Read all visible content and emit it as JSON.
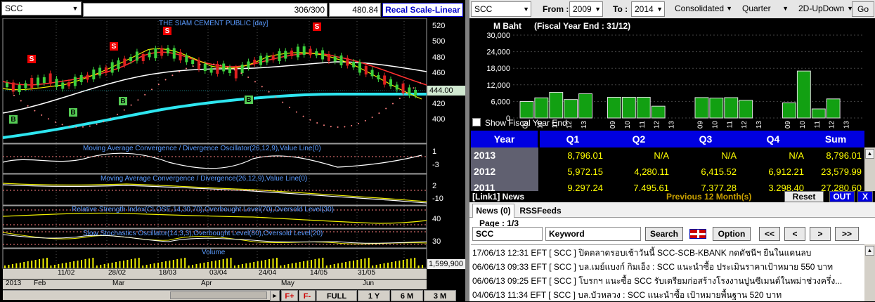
{
  "left": {
    "symbol": "SCC",
    "counter": "306/300",
    "price_readout": "480.84",
    "recal_label": "Recal Scale-Linear",
    "panels": {
      "price_title": "THE SIAM CEMENT PUBLIC [day]",
      "macd_osc_title": "Moving Average Convergence / Divergence Oscillator(26,12,9),Value Line(0)",
      "macd_title": "Moving Average Convergence / Divergence(26,12,9),Value Line(0)",
      "rsi_title": "Relative Strength Index(CLOSE,14,30,70),Overbought Level(70),Oversold Level(30)",
      "stoch_title": "Slow Stochastics Oscillator(14,3,3),Overbought Level(80),Oversold Level(20)",
      "volume_title": "Volume"
    },
    "price_axis": [
      "520",
      "500",
      "480",
      "460",
      "440",
      "420",
      "400"
    ],
    "current_price_badge": "444.00",
    "osc_axis": [
      "1",
      "-3"
    ],
    "macd_axis": [
      "2",
      "-10"
    ],
    "rsi_axis": [
      "40"
    ],
    "stoch_axis": [
      "30"
    ],
    "volume_badge": "1,599,900",
    "signals": [
      {
        "type": "S",
        "label": "S"
      },
      {
        "type": "S",
        "label": "S"
      },
      {
        "type": "S",
        "label": "S"
      },
      {
        "type": "S",
        "label": "S"
      },
      {
        "type": "B",
        "label": "B"
      },
      {
        "type": "B",
        "label": "B"
      },
      {
        "type": "B",
        "label": "B"
      },
      {
        "type": "B",
        "label": "B"
      }
    ],
    "date_ticks": [
      "11/02",
      "28/02",
      "18/03",
      "03/04",
      "24/04",
      "14/05",
      "31/05"
    ],
    "month_ticks": [
      "2013",
      "Feb",
      "Mar",
      "Apr",
      "May",
      "Jun"
    ],
    "buttons": {
      "font_up": "F+",
      "font_down": "F-",
      "full": "FULL",
      "y1": "1 Y",
      "m6": "6 M",
      "m3": "3 M"
    }
  },
  "right": {
    "symbol": "SCC",
    "from_label": "From :",
    "from_value": "2009",
    "to_label": "To :",
    "to_value": "2014",
    "consolidation": "Consolidated",
    "period": "Quarter",
    "view": "2D-UpDown",
    "go_label": "Go",
    "unit": "M Baht",
    "fiscal_note": "(Fiscal Year End : 31/12)",
    "show_fiscal_label": "Show Fiscal Year End",
    "chart_data": {
      "type": "bar",
      "ylim": [
        0,
        30000
      ],
      "yticks": [
        "30,000",
        "24,000",
        "18,000",
        "12,000",
        "6,000",
        "0"
      ],
      "groups": [
        {
          "name": "Q1",
          "categories": [
            "09",
            "10",
            "11",
            "12",
            "13"
          ],
          "values": [
            5972,
            7300,
            9297,
            6700,
            8796
          ]
        },
        {
          "name": "Q2",
          "categories": [
            "09",
            "10",
            "11",
            "12",
            "13"
          ],
          "values": [
            7500,
            7500,
            7496,
            4280,
            null
          ]
        },
        {
          "name": "Q3",
          "categories": [
            "09",
            "10",
            "11",
            "12",
            "13"
          ],
          "values": [
            7400,
            7200,
            7377,
            6416,
            null
          ]
        },
        {
          "name": "Q4",
          "categories": [
            "09",
            "10",
            "11",
            "12",
            "13"
          ],
          "values": [
            5500,
            17000,
            3300,
            6912,
            null
          ]
        }
      ]
    },
    "table": {
      "headers": [
        "Year",
        "Q1",
        "Q2",
        "Q3",
        "Q4",
        "Sum"
      ],
      "rows": [
        {
          "year": "2013",
          "q1": "8,796.01",
          "q2": "N/A",
          "q3": "N/A",
          "q4": "N/A",
          "sum": "8,796.01"
        },
        {
          "year": "2012",
          "q1": "5,972.15",
          "q2": "4,280.11",
          "q3": "6,415.52",
          "q4": "6,912.21",
          "sum": "23,579.99"
        },
        {
          "year": "2011",
          "q1": "9,297.24",
          "q2": "7,495.61",
          "q3": "7,377.28",
          "q4": "3,298.40",
          "sum": "27,280.60"
        }
      ]
    },
    "news": {
      "panel_label": "[Link1] News",
      "previous_label": "Previous 12 Month(s)",
      "reset_label": "Reset",
      "out_label": "OUT",
      "close_label": "X",
      "tab_news": "News (0)",
      "tab_rss": "RSSFeeds",
      "page_label": "Page : 1/3",
      "symbol_value": "SCC",
      "keyword_value": "Keyword",
      "search_label": "Search",
      "option_label": "Option",
      "nav": [
        "<<",
        "<",
        ">",
        ">>"
      ],
      "items": [
        {
          "ts": "17/06/13 12:31",
          "src": "EFT",
          "sym": "[ SCC ]",
          "text": "ปิดตลาดรอบเช้าวันนี้ SCC-SCB-KBANK กดดัชนีฯ ยืนในแดนลบ"
        },
        {
          "ts": "06/06/13 09:33",
          "src": "EFT",
          "sym": "[ SCC ]",
          "text": "บล.เมย์แบงก์ กิมเอ็ง : SCC แนะนำซื้อ ประเมินราคาเป้าหมาย 550 บาท"
        },
        {
          "ts": "06/06/13 09:25",
          "src": "EFT",
          "sym": "[ SCC ]",
          "text": "โบรกฯ แนะซื้อ SCC รับเตรียมก่อสร้างโรงงานปูนซีเมนต์ในพม่าช่วงครึ่ง..."
        },
        {
          "ts": "04/06/13 11:34",
          "src": "EFT",
          "sym": "[ SCC ]",
          "text": "บล.บัวหลวง : SCC แนะนำซื้อ เป้าหมายพื้นฐาน 520 บาท"
        }
      ]
    }
  }
}
